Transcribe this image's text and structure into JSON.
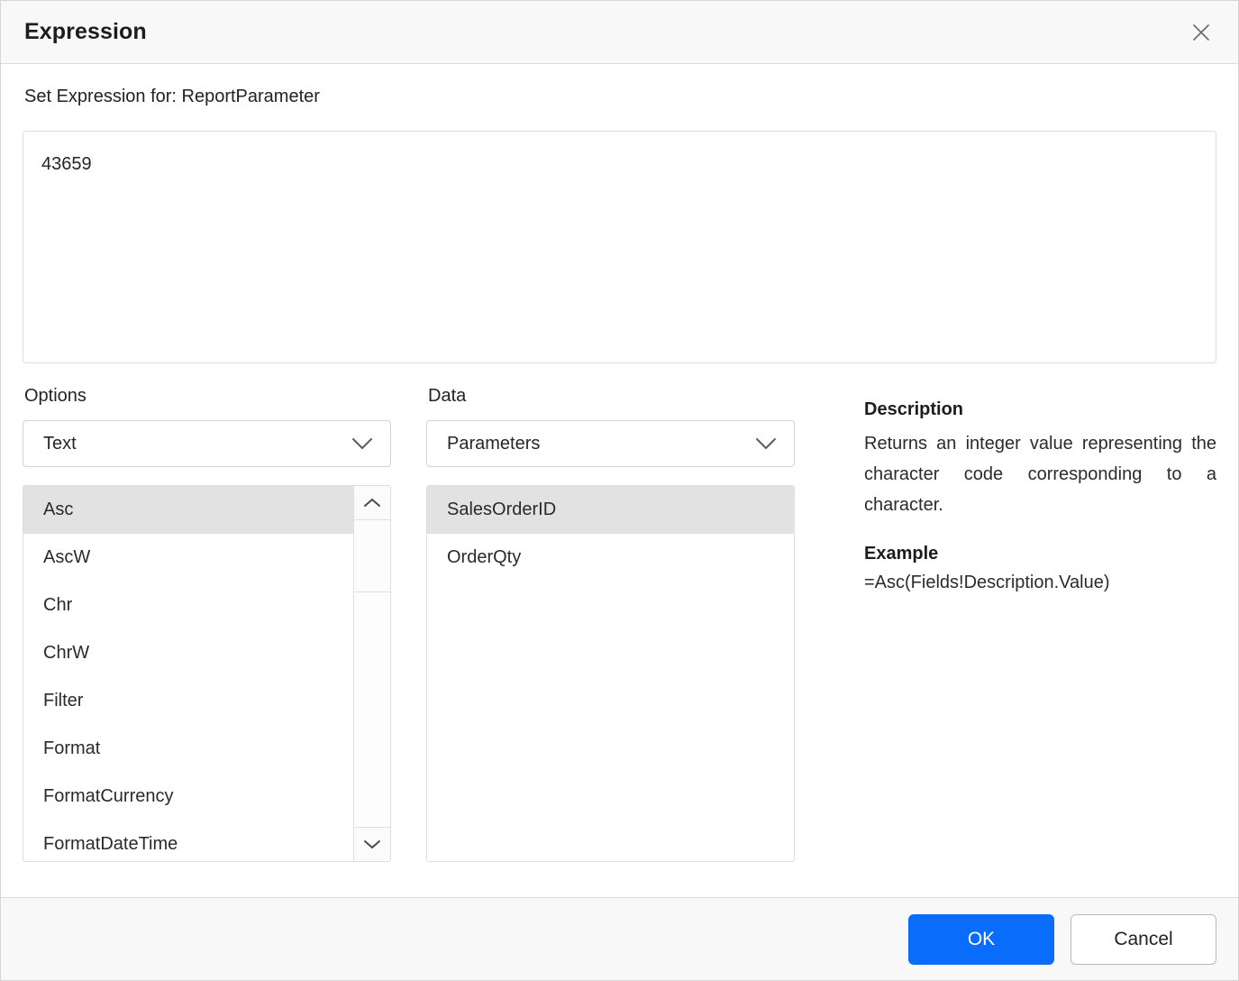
{
  "dialog": {
    "title": "Expression",
    "close_icon": "close-icon",
    "subtitle": "Set Expression for: ReportParameter"
  },
  "expression": {
    "value": "43659",
    "placeholder": ""
  },
  "options": {
    "label": "Options",
    "category_selected": "Text",
    "category_chevron": "chevron-down-icon",
    "items": [
      {
        "label": "Asc",
        "selected": true
      },
      {
        "label": "AscW",
        "selected": false
      },
      {
        "label": "Chr",
        "selected": false
      },
      {
        "label": "ChrW",
        "selected": false
      },
      {
        "label": "Filter",
        "selected": false
      },
      {
        "label": "Format",
        "selected": false
      },
      {
        "label": "FormatCurrency",
        "selected": false
      },
      {
        "label": "FormatDateTime",
        "selected": false
      }
    ],
    "scrollbar": {
      "up_icon": "chevron-up-icon",
      "down_icon": "chevron-down-icon"
    }
  },
  "data": {
    "label": "Data",
    "category_selected": "Parameters",
    "category_chevron": "chevron-down-icon",
    "items": [
      {
        "label": "SalesOrderID",
        "selected": true
      },
      {
        "label": "OrderQty",
        "selected": false
      }
    ]
  },
  "description": {
    "heading": "Description",
    "body": "Returns an integer value representing the character code corresponding to a character.",
    "example_heading": "Example",
    "example_body": "=Asc(Fields!Description.Value)"
  },
  "footer": {
    "ok_label": "OK",
    "cancel_label": "Cancel"
  },
  "colors": {
    "primary": "#0a6cfa",
    "header_bg": "#f8f8f8",
    "selection_bg": "#e2e2e2",
    "border": "#dcdcdc"
  }
}
